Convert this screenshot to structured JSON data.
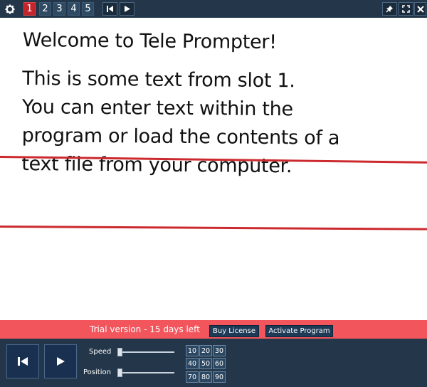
{
  "toolbar": {
    "settings_icon": "gear-icon",
    "slots": [
      "1",
      "2",
      "3",
      "4",
      "5"
    ],
    "active_slot": "1",
    "rewind_icon": "skip-to-start-icon",
    "play_icon": "play-icon",
    "pin_icon": "pin-icon",
    "fullscreen_icon": "fullscreen-icon",
    "close_icon": "close-icon"
  },
  "prompt": {
    "heading": "Welcome to Tele Prompter!",
    "lines": [
      "This is some text from slot 1.",
      "You can enter text within the",
      "program or load the contents of a",
      "text file from your computer."
    ],
    "marker_color": "#cc2a2e"
  },
  "trial": {
    "text": "Trial version - 15 days left",
    "buy_label": "Buy License",
    "activate_label": "Activate Program",
    "bar_color": "#f2565c"
  },
  "controls": {
    "rewind_icon": "skip-to-start-icon",
    "play_icon": "play-icon",
    "speed_label": "Speed",
    "position_label": "Position",
    "speed_level": 0.0,
    "position_level": 0.0,
    "presets": [
      "10",
      "20",
      "30",
      "40",
      "50",
      "60",
      "70",
      "80",
      "90"
    ]
  }
}
